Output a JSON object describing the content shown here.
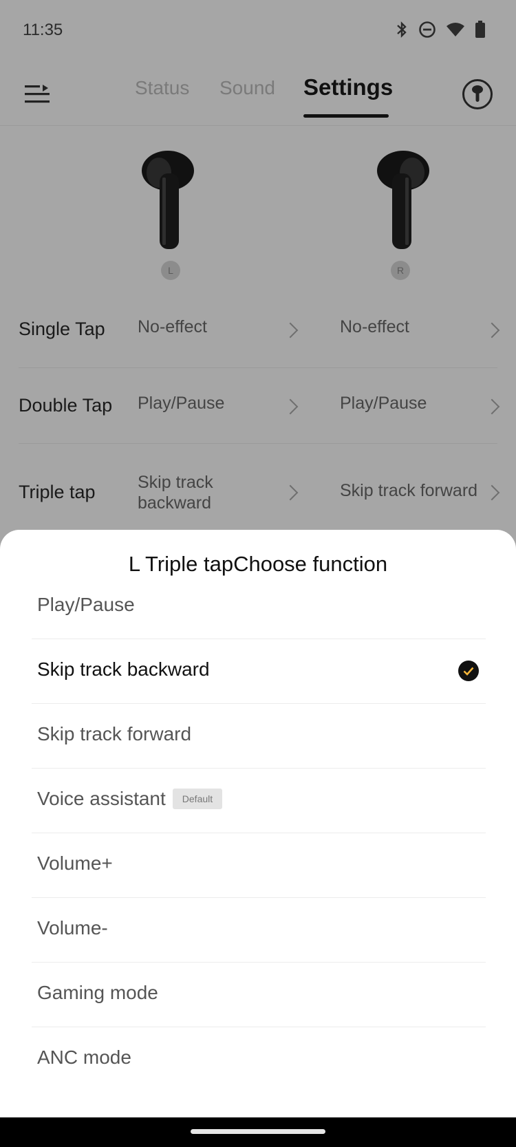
{
  "status_bar": {
    "time": "11:35",
    "icons": [
      "bluetooth-icon",
      "do-not-disturb-icon",
      "wifi-icon",
      "battery-icon"
    ]
  },
  "nav": {
    "tabs": [
      {
        "label": "Status"
      },
      {
        "label": "Sound"
      },
      {
        "label": "Settings"
      }
    ],
    "active_tab": "Settings"
  },
  "earbuds": {
    "left_label": "L",
    "right_label": "R"
  },
  "gestures": [
    {
      "name": "Single Tap",
      "left": "No-effect",
      "right": "No-effect"
    },
    {
      "name": "Double Tap",
      "left": "Play/Pause",
      "right": "Play/Pause"
    },
    {
      "name": "Triple tap",
      "left": "Skip track\nbackward",
      "right": "Skip track forward"
    }
  ],
  "sheet": {
    "title": "L Triple tapChoose function",
    "options": [
      {
        "label": "Play/Pause"
      },
      {
        "label": "Skip track backward",
        "selected": true
      },
      {
        "label": "Skip track forward"
      },
      {
        "label": "Voice assistant",
        "badge": "Default"
      },
      {
        "label": "Volume+"
      },
      {
        "label": "Volume-"
      },
      {
        "label": "Gaming mode"
      },
      {
        "label": "ANC mode"
      }
    ]
  },
  "colors": {
    "overlay_bg": "#a6a6a6",
    "check_accent": "#f5b53a"
  }
}
